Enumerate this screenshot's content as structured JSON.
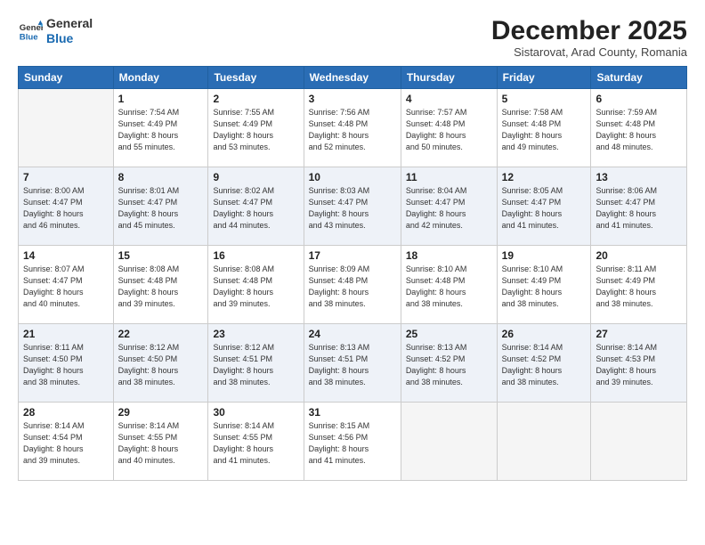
{
  "header": {
    "logo_line1": "General",
    "logo_line2": "Blue",
    "month": "December 2025",
    "location": "Sistarovat, Arad County, Romania"
  },
  "weekdays": [
    "Sunday",
    "Monday",
    "Tuesday",
    "Wednesday",
    "Thursday",
    "Friday",
    "Saturday"
  ],
  "weeks": [
    [
      {
        "day": "",
        "info": ""
      },
      {
        "day": "1",
        "info": "Sunrise: 7:54 AM\nSunset: 4:49 PM\nDaylight: 8 hours\nand 55 minutes."
      },
      {
        "day": "2",
        "info": "Sunrise: 7:55 AM\nSunset: 4:49 PM\nDaylight: 8 hours\nand 53 minutes."
      },
      {
        "day": "3",
        "info": "Sunrise: 7:56 AM\nSunset: 4:48 PM\nDaylight: 8 hours\nand 52 minutes."
      },
      {
        "day": "4",
        "info": "Sunrise: 7:57 AM\nSunset: 4:48 PM\nDaylight: 8 hours\nand 50 minutes."
      },
      {
        "day": "5",
        "info": "Sunrise: 7:58 AM\nSunset: 4:48 PM\nDaylight: 8 hours\nand 49 minutes."
      },
      {
        "day": "6",
        "info": "Sunrise: 7:59 AM\nSunset: 4:48 PM\nDaylight: 8 hours\nand 48 minutes."
      }
    ],
    [
      {
        "day": "7",
        "info": "Sunrise: 8:00 AM\nSunset: 4:47 PM\nDaylight: 8 hours\nand 46 minutes."
      },
      {
        "day": "8",
        "info": "Sunrise: 8:01 AM\nSunset: 4:47 PM\nDaylight: 8 hours\nand 45 minutes."
      },
      {
        "day": "9",
        "info": "Sunrise: 8:02 AM\nSunset: 4:47 PM\nDaylight: 8 hours\nand 44 minutes."
      },
      {
        "day": "10",
        "info": "Sunrise: 8:03 AM\nSunset: 4:47 PM\nDaylight: 8 hours\nand 43 minutes."
      },
      {
        "day": "11",
        "info": "Sunrise: 8:04 AM\nSunset: 4:47 PM\nDaylight: 8 hours\nand 42 minutes."
      },
      {
        "day": "12",
        "info": "Sunrise: 8:05 AM\nSunset: 4:47 PM\nDaylight: 8 hours\nand 41 minutes."
      },
      {
        "day": "13",
        "info": "Sunrise: 8:06 AM\nSunset: 4:47 PM\nDaylight: 8 hours\nand 41 minutes."
      }
    ],
    [
      {
        "day": "14",
        "info": "Sunrise: 8:07 AM\nSunset: 4:47 PM\nDaylight: 8 hours\nand 40 minutes."
      },
      {
        "day": "15",
        "info": "Sunrise: 8:08 AM\nSunset: 4:48 PM\nDaylight: 8 hours\nand 39 minutes."
      },
      {
        "day": "16",
        "info": "Sunrise: 8:08 AM\nSunset: 4:48 PM\nDaylight: 8 hours\nand 39 minutes."
      },
      {
        "day": "17",
        "info": "Sunrise: 8:09 AM\nSunset: 4:48 PM\nDaylight: 8 hours\nand 38 minutes."
      },
      {
        "day": "18",
        "info": "Sunrise: 8:10 AM\nSunset: 4:48 PM\nDaylight: 8 hours\nand 38 minutes."
      },
      {
        "day": "19",
        "info": "Sunrise: 8:10 AM\nSunset: 4:49 PM\nDaylight: 8 hours\nand 38 minutes."
      },
      {
        "day": "20",
        "info": "Sunrise: 8:11 AM\nSunset: 4:49 PM\nDaylight: 8 hours\nand 38 minutes."
      }
    ],
    [
      {
        "day": "21",
        "info": "Sunrise: 8:11 AM\nSunset: 4:50 PM\nDaylight: 8 hours\nand 38 minutes."
      },
      {
        "day": "22",
        "info": "Sunrise: 8:12 AM\nSunset: 4:50 PM\nDaylight: 8 hours\nand 38 minutes."
      },
      {
        "day": "23",
        "info": "Sunrise: 8:12 AM\nSunset: 4:51 PM\nDaylight: 8 hours\nand 38 minutes."
      },
      {
        "day": "24",
        "info": "Sunrise: 8:13 AM\nSunset: 4:51 PM\nDaylight: 8 hours\nand 38 minutes."
      },
      {
        "day": "25",
        "info": "Sunrise: 8:13 AM\nSunset: 4:52 PM\nDaylight: 8 hours\nand 38 minutes."
      },
      {
        "day": "26",
        "info": "Sunrise: 8:14 AM\nSunset: 4:52 PM\nDaylight: 8 hours\nand 38 minutes."
      },
      {
        "day": "27",
        "info": "Sunrise: 8:14 AM\nSunset: 4:53 PM\nDaylight: 8 hours\nand 39 minutes."
      }
    ],
    [
      {
        "day": "28",
        "info": "Sunrise: 8:14 AM\nSunset: 4:54 PM\nDaylight: 8 hours\nand 39 minutes."
      },
      {
        "day": "29",
        "info": "Sunrise: 8:14 AM\nSunset: 4:55 PM\nDaylight: 8 hours\nand 40 minutes."
      },
      {
        "day": "30",
        "info": "Sunrise: 8:14 AM\nSunset: 4:55 PM\nDaylight: 8 hours\nand 41 minutes."
      },
      {
        "day": "31",
        "info": "Sunrise: 8:15 AM\nSunset: 4:56 PM\nDaylight: 8 hours\nand 41 minutes."
      },
      {
        "day": "",
        "info": ""
      },
      {
        "day": "",
        "info": ""
      },
      {
        "day": "",
        "info": ""
      }
    ]
  ]
}
